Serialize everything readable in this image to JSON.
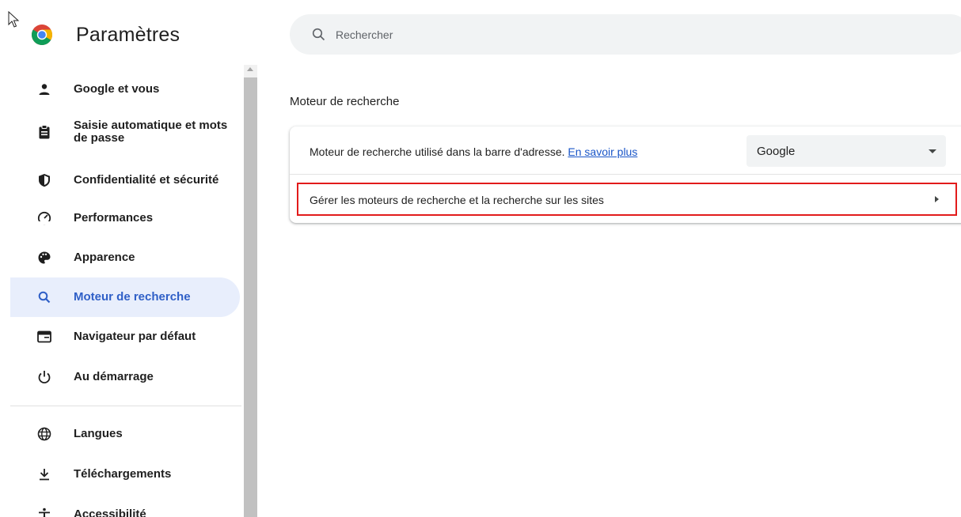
{
  "header": {
    "title": "Paramètres",
    "search_placeholder": "Rechercher"
  },
  "sidebar": {
    "items": [
      {
        "label": "Google et vous",
        "icon": "person-icon"
      },
      {
        "label": "Saisie automatique et mots de passe",
        "icon": "clipboard-icon"
      },
      {
        "label": "Confidentialité et sécurité",
        "icon": "shield-icon"
      },
      {
        "label": "Performances",
        "icon": "speedometer-icon"
      },
      {
        "label": "Apparence",
        "icon": "palette-icon"
      },
      {
        "label": "Moteur de recherche",
        "icon": "search-icon",
        "active": true
      },
      {
        "label": "Navigateur par défaut",
        "icon": "browser-window-icon"
      },
      {
        "label": "Au démarrage",
        "icon": "power-icon"
      },
      {
        "label": "Langues",
        "icon": "globe-icon"
      },
      {
        "label": "Téléchargements",
        "icon": "download-icon"
      },
      {
        "label": "Accessibilité",
        "icon": "accessibility-icon"
      }
    ]
  },
  "main": {
    "section_title": "Moteur de recherche",
    "engine_row": {
      "description": "Moteur de recherche utilisé dans la barre d'adresse.",
      "link": "En savoir plus",
      "selected_engine": "Google"
    },
    "manage_row": {
      "label": "Gérer les moteurs de recherche et la recherche sur les sites"
    }
  },
  "colors": {
    "accent": "#1a56c8",
    "active_bg": "#e8eefc",
    "highlight_border": "#e21b1b"
  }
}
